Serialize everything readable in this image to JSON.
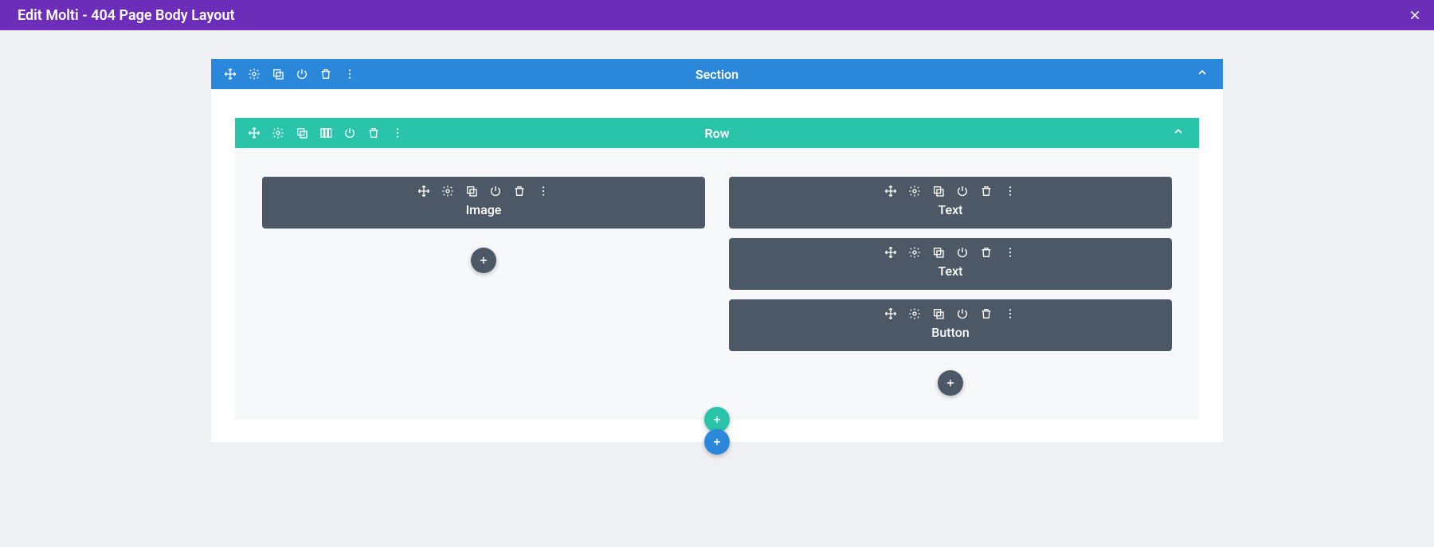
{
  "header": {
    "title": "Edit Molti - 404 Page Body Layout"
  },
  "section": {
    "label": "Section"
  },
  "row": {
    "label": "Row"
  },
  "modules": {
    "left": [
      {
        "label": "Image"
      }
    ],
    "right": [
      {
        "label": "Text"
      },
      {
        "label": "Text"
      },
      {
        "label": "Button"
      }
    ]
  },
  "colors": {
    "purple": "#6c2eb9",
    "blue": "#2b87da",
    "teal": "#29c4a9",
    "dark": "#4c5866"
  }
}
